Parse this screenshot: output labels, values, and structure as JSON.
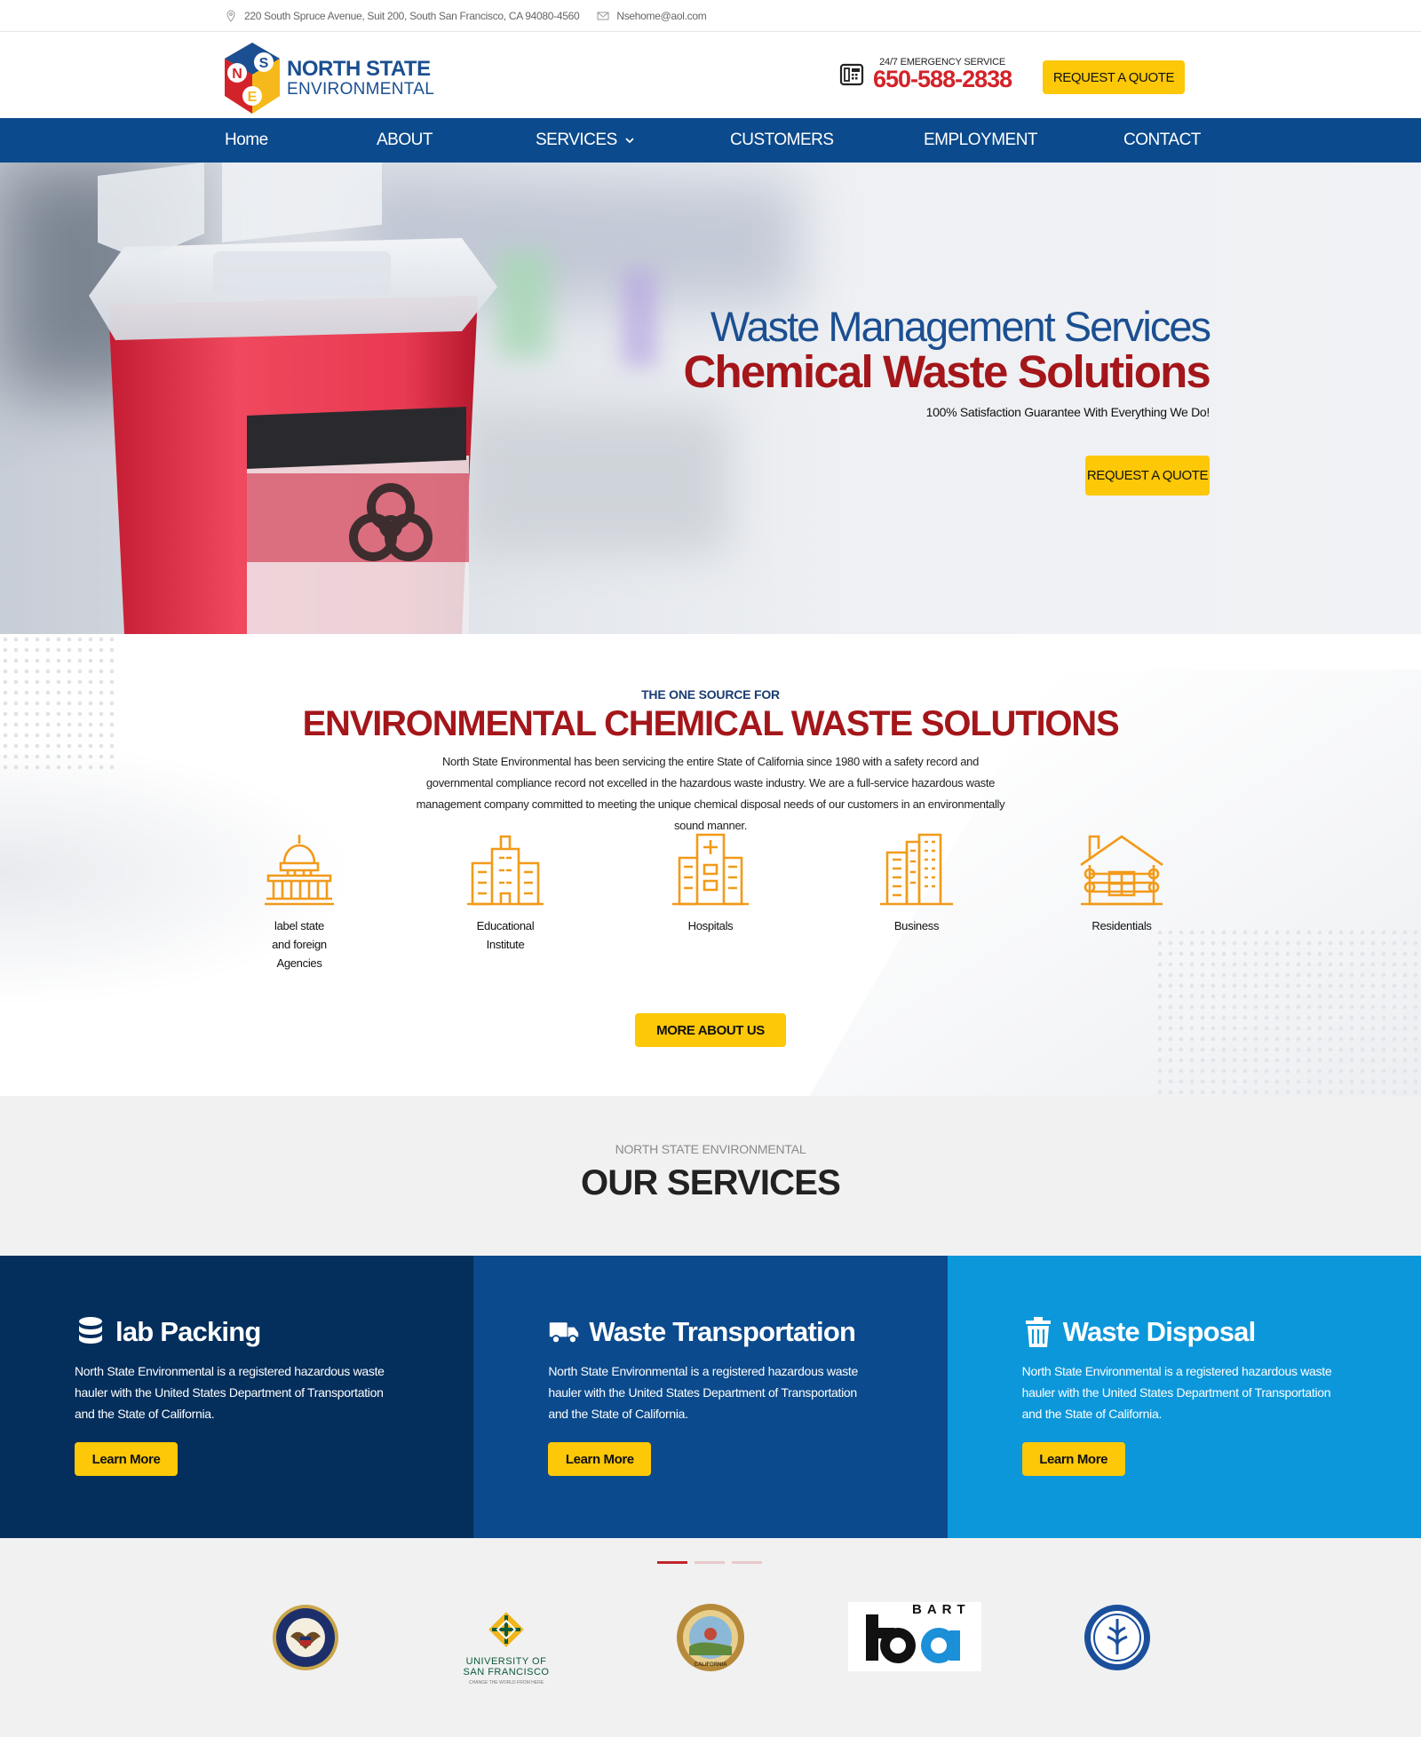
{
  "topbar": {
    "address": "220 South Spruce Avenue, Suit 200, South San Francisco, CA 94080-4560",
    "email": "Nsehome@aol.com"
  },
  "header": {
    "logo_line1": "NORTH STATE",
    "logo_line2": "ENVIRONMENTAL",
    "emergency_label": "24/7 EMERGENCY SERVICE",
    "phone": "650-588-2838",
    "quote_button": "REQUEST A QUOTE"
  },
  "nav": {
    "items": [
      "Home",
      "ABOUT",
      "SERVICES",
      "CUSTOMERS",
      "EMPLOYMENT",
      "CONTACT"
    ]
  },
  "hero": {
    "subtitle": "Waste Management Services",
    "title": "Chemical Waste Solutions",
    "tagline": "100% Satisfaction Guarantee With Everything We Do!",
    "quote_button": "REQUEST A QUOTE"
  },
  "about": {
    "kicker": "THE ONE SOURCE FOR",
    "title": "ENVIRONMENTAL CHEMICAL WASTE SOLUTIONS",
    "description": "North State Environmental has been servicing the entire State of California since 1980 with a safety record and governmental compliance record not excelled in the hazardous waste industry. We are a full-service hazardous waste management company committed to meeting the unique chemical disposal needs of our customers in an environmentally sound manner.",
    "categories": [
      {
        "label": "label state and foreign Agencies",
        "icon": "capitol-icon"
      },
      {
        "label": "Educational Institute",
        "icon": "school-icon"
      },
      {
        "label": "Hospitals",
        "icon": "hospital-icon"
      },
      {
        "label": "Business",
        "icon": "office-building-icon"
      },
      {
        "label": "Residentials",
        "icon": "house-icon"
      }
    ],
    "more_button": "MORE ABOUT US"
  },
  "services": {
    "kicker": "NORTH STATE ENVIRONMENTAL",
    "title": "OUR SERVICES",
    "cards": [
      {
        "title": "lab Packing",
        "icon": "database-icon",
        "text": "North State Environmental is a registered hazardous waste hauler with the United States Department of Transportation and the State of California.",
        "button": "Learn More",
        "color": "#042e5c"
      },
      {
        "title": "Waste Transportation",
        "icon": "truck-icon",
        "text": "North State Environmental is a registered hazardous waste hauler with the United States Department of Transportation and the State of California.",
        "button": "Learn More",
        "color": "#0b4a8c"
      },
      {
        "title": "Waste Disposal",
        "icon": "trash-icon",
        "text": "North State Environmental is a registered hazardous waste hauler with the United States Department of Transportation and the State of California.",
        "button": "Learn More",
        "color": "#0c97db"
      }
    ]
  },
  "customers": {
    "logos": [
      {
        "name": "veterans-affairs-seal",
        "text": ""
      },
      {
        "name": "usf-logo",
        "line1": "UNIVERSITY OF",
        "line2": "SAN FRANCISCO",
        "line3": "CHANGE THE WORLD FROM HERE"
      },
      {
        "name": "california-seal",
        "text": "CALIFORNIA"
      },
      {
        "name": "bart-logo",
        "text": "BART"
      },
      {
        "name": "lacc-seal",
        "text": ""
      }
    ]
  },
  "colors": {
    "navy": "#0b4a8c",
    "red": "#a4161a",
    "yellow": "#fcc808",
    "phone_red": "#d3232a"
  }
}
